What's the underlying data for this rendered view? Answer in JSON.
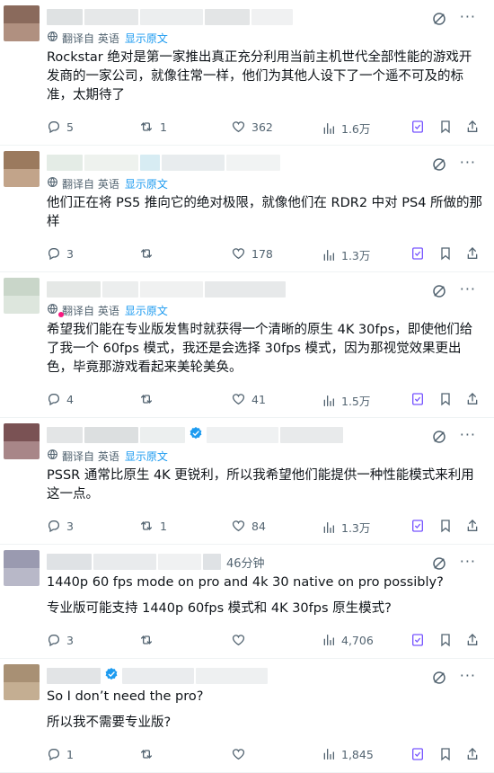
{
  "posts": [
    {
      "time": "",
      "translate": {
        "label": "翻译自 英语",
        "show": "显示原文"
      },
      "text": "Rockstar 绝对是第一家推出真正充分利用当前主机世代全部性能的游戏开发商的一家公司，就像往常一样，他们为其他人设下了一个遥不可及的标准，太期待了",
      "reply": "5",
      "retweet": "1",
      "like": "362",
      "views": "1.6万",
      "avatar_colors": [
        "#8a6a5c",
        "#b09080"
      ],
      "verified": false
    },
    {
      "time": "",
      "translate": {
        "label": "翻译自 英语",
        "show": "显示原文"
      },
      "text": "他们正在将 PS5 推向它的绝对极限，就像他们在 RDR2 中对 PS4 所做的那样",
      "reply": "3",
      "retweet": "",
      "like": "178",
      "views": "1.3万",
      "avatar_colors": [
        "#9b7a5e",
        "#c2a48a"
      ],
      "verified": false
    },
    {
      "time": "",
      "translate": {
        "label": "翻译自 英语",
        "show": "显示原文"
      },
      "text": "希望我们能在专业版发售时就获得一个清晰的原生 4K 30fps，即使他们给了我一个 60fps 模式，我还是会选择 30fps 模式，因为那视觉效果更出色，毕竟那游戏看起来美轮美奂。",
      "reply": "4",
      "retweet": "",
      "like": "41",
      "views": "1.5万",
      "avatar_colors": [
        "#c9d6c9",
        "#dde6dd"
      ],
      "verified": false
    },
    {
      "time": "",
      "translate": {
        "label": "翻译自 英语",
        "show": "显示原文"
      },
      "text": "PSSR 通常比原生 4K 更锐利，所以我希望他们能提供一种性能模式来利用这一点。",
      "reply": "3",
      "retweet": "1",
      "like": "84",
      "views": "1.3万",
      "avatar_colors": [
        "#7a5254",
        "#a88688"
      ],
      "verified": true
    },
    {
      "time": "46分钟",
      "translate": null,
      "text": "1440p 60 fps mode on pro and 4k 30 native on pro possibly?",
      "text2": "专业版可能支持 1440p 60fps 模式和 4K 30fps 原生模式?",
      "reply": "3",
      "retweet": "",
      "like": "",
      "views": "4,706",
      "avatar_colors": [
        "#9a9ab0",
        "#b8b8c8"
      ],
      "verified": false
    },
    {
      "time": "",
      "translate": null,
      "text": "So I don’t need the pro?",
      "text2": "所以我不需要专业版?",
      "reply": "1",
      "retweet": "",
      "like": "",
      "views": "1,845",
      "avatar_colors": [
        "#a89074",
        "#c4ae92"
      ],
      "verified": true
    }
  ],
  "colors": {
    "accent": "#1d9bf0",
    "muted": "#536471",
    "text": "#0f1419"
  },
  "icons": [
    "reply-icon",
    "retweet-icon",
    "like-icon",
    "views-icon",
    "grok-icon",
    "bookmark-icon",
    "share-icon",
    "translate-icon",
    "verified-icon",
    "more-icon"
  ]
}
